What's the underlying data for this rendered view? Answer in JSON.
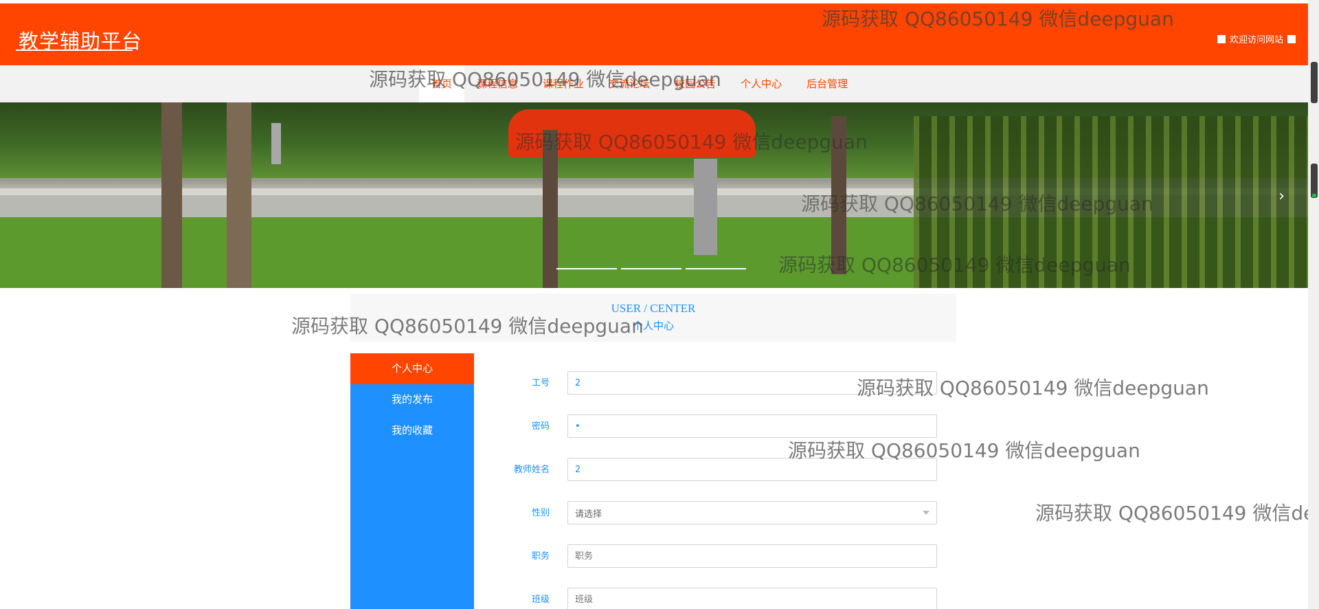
{
  "header": {
    "logo": "教学辅助平台",
    "welcome": "欢迎访问网站"
  },
  "nav": {
    "items": [
      {
        "label": "首页"
      },
      {
        "label": "课程信息"
      },
      {
        "label": "课程作业"
      },
      {
        "label": "交流论坛"
      },
      {
        "label": "校园公告"
      },
      {
        "label": "个人中心"
      },
      {
        "label": "后台管理"
      }
    ]
  },
  "center": {
    "title_en": "USER / CENTER",
    "title_cn": "个人中心"
  },
  "sidebar": {
    "items": [
      {
        "label": "个人中心"
      },
      {
        "label": "我的发布"
      },
      {
        "label": "我的收藏"
      }
    ]
  },
  "form": {
    "fields": [
      {
        "label": "工号",
        "value": "2"
      },
      {
        "label": "密码",
        "value": "•"
      },
      {
        "label": "教师姓名",
        "value": "2"
      },
      {
        "label": "性别",
        "value": "请选择"
      },
      {
        "label": "职务",
        "placeholder": "职务"
      },
      {
        "label": "班级",
        "placeholder": "班级"
      }
    ]
  },
  "watermark": "源码获取 QQ86050149 微信deepguan",
  "colors": {
    "brand": "#ff4500",
    "accent": "#1e90ff"
  }
}
